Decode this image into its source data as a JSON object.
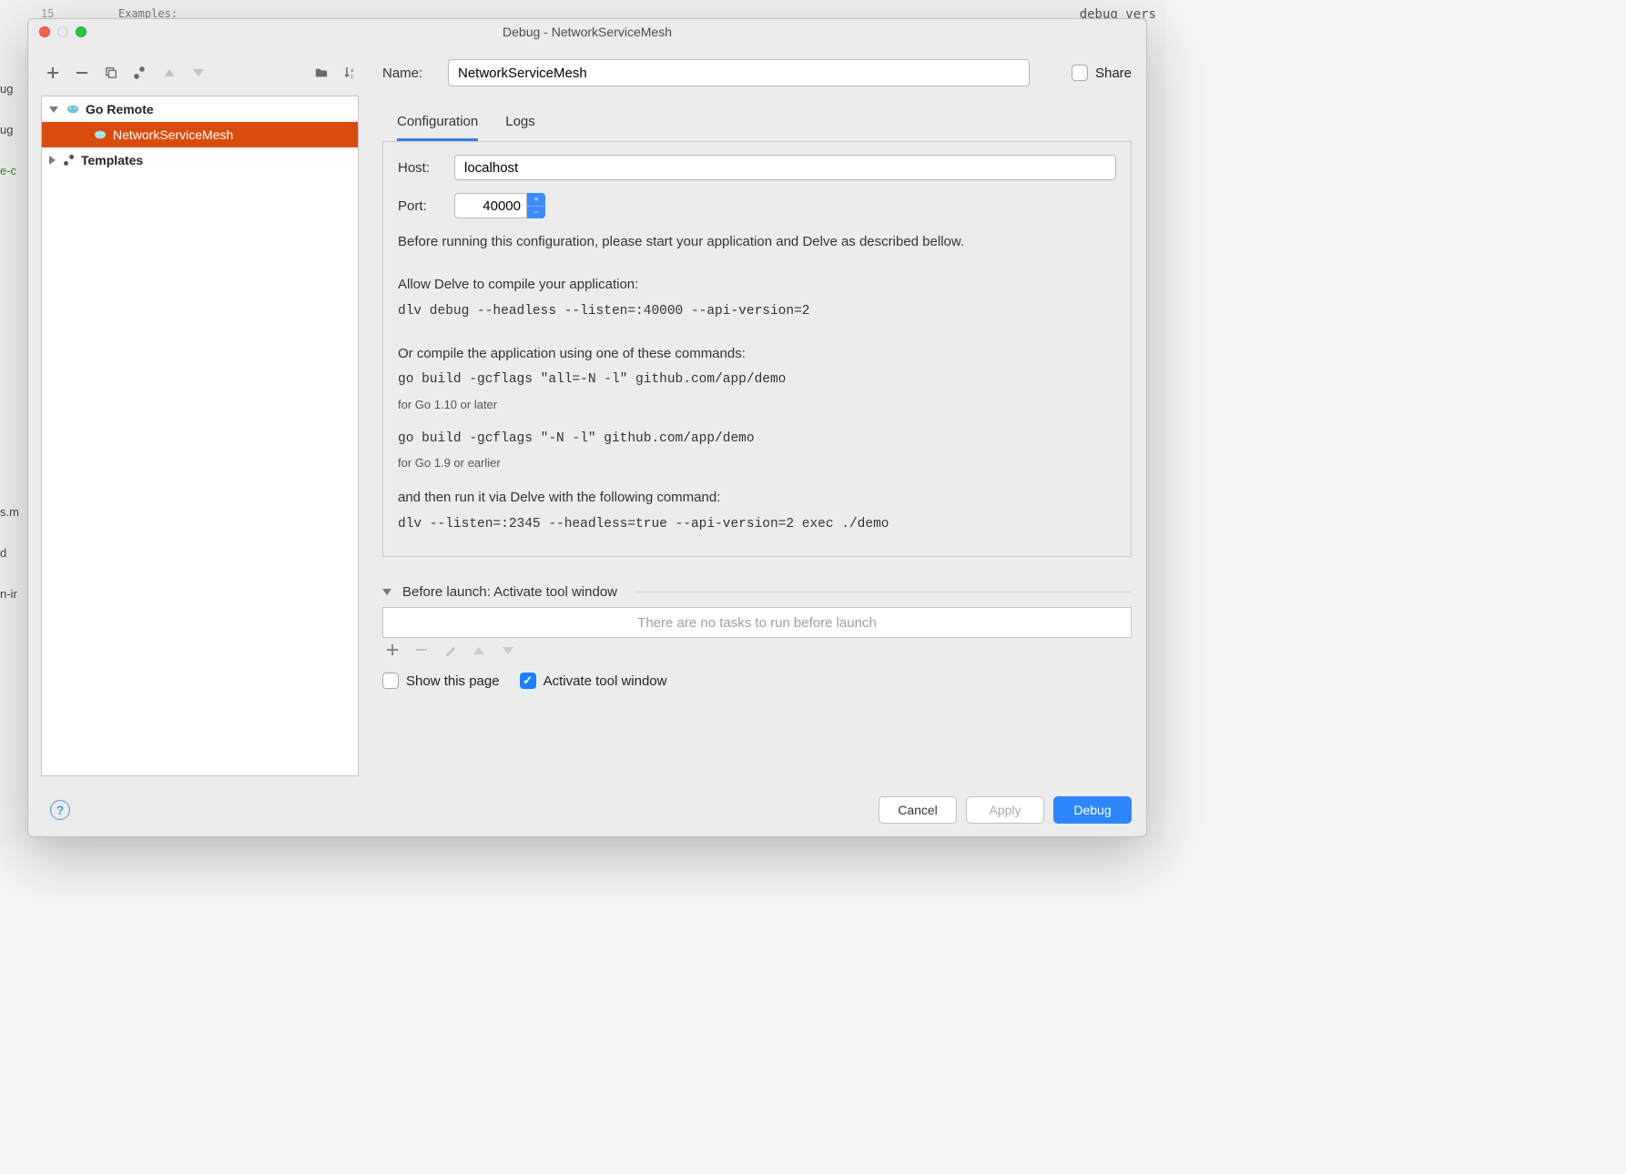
{
  "bg": {
    "line_num": "15",
    "examples": "Examples:",
    "right": "debug vers"
  },
  "titlebar": {
    "title": "Debug - NetworkServiceMesh"
  },
  "tree": {
    "root": "Go Remote",
    "selected": "NetworkServiceMesh",
    "templates": "Templates"
  },
  "form": {
    "name_label": "Name:",
    "name_value": "NetworkServiceMesh",
    "share_label": "Share",
    "tabs": {
      "config": "Configuration",
      "logs": "Logs"
    },
    "host_label": "Host:",
    "host_value": "localhost",
    "port_label": "Port:",
    "port_value": "40000",
    "desc_intro": "Before running this configuration, please start your application and Delve as described bellow.",
    "desc_allow": "Allow Delve to compile your application:",
    "cmd1": "dlv debug --headless --listen=:40000 --api-version=2",
    "desc_orcompile": "Or compile the application using one of these commands:",
    "cmd2": "go build -gcflags \"all=-N -l\" github.com/app/demo",
    "note1": "for Go 1.10 or later",
    "cmd3": "go build -gcflags \"-N -l\" github.com/app/demo",
    "note2": "for Go 1.9 or earlier",
    "desc_then": "and then run it via Delve with the following command:",
    "cmd4": "dlv --listen=:2345 --headless=true --api-version=2 exec ./demo"
  },
  "before_launch": {
    "header": "Before launch: Activate tool window",
    "empty": "There are no tasks to run before launch"
  },
  "checks": {
    "show_page": "Show this page",
    "activate": "Activate tool window"
  },
  "buttons": {
    "cancel": "Cancel",
    "apply": "Apply",
    "debug": "Debug"
  }
}
